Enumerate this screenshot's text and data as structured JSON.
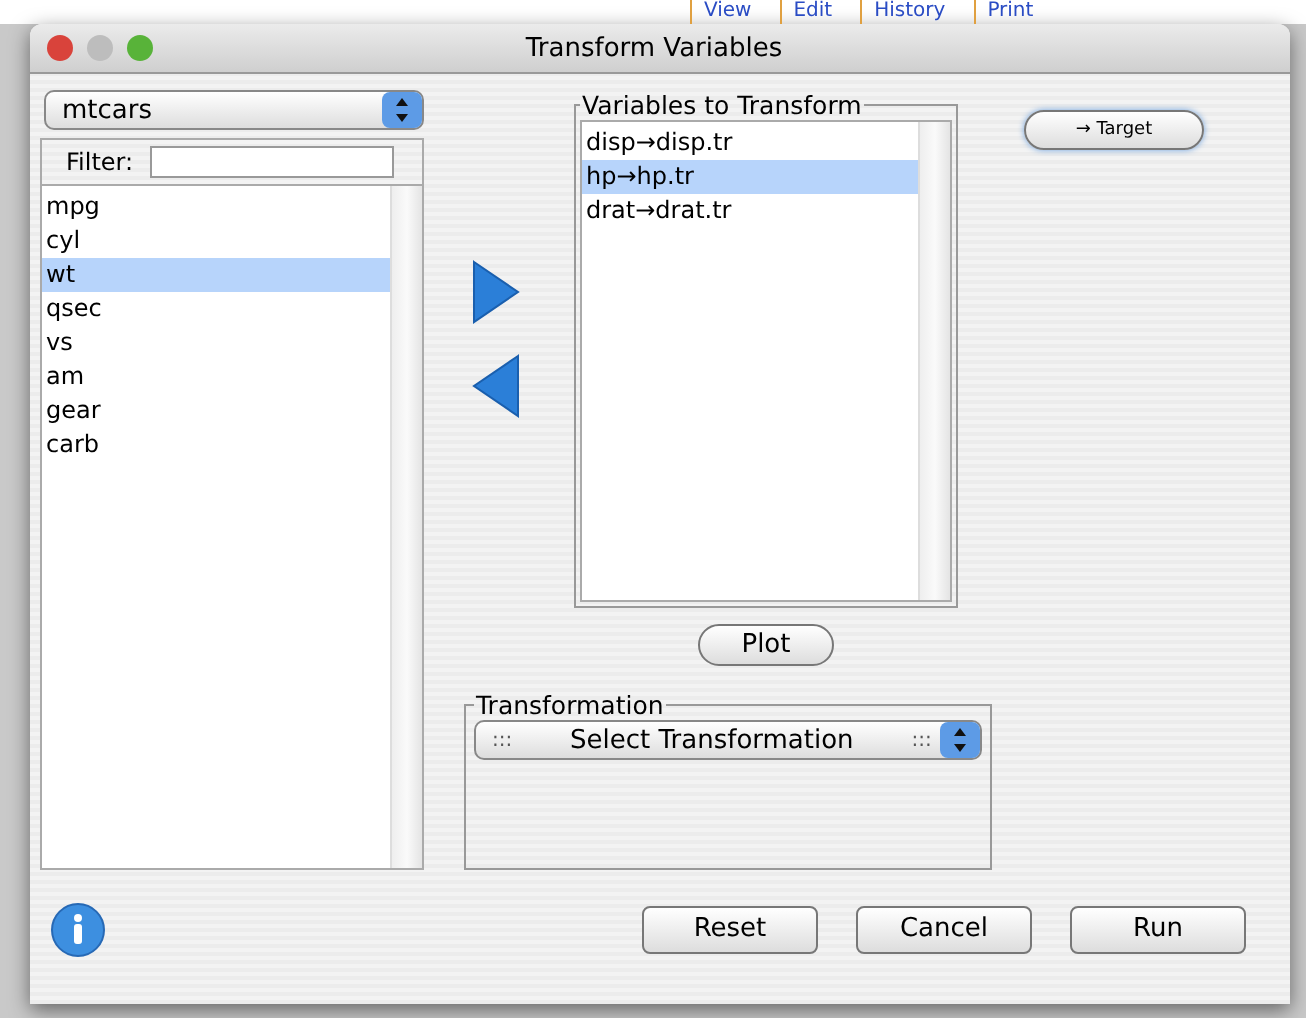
{
  "background_tabs": [
    "View",
    "Edit",
    "History",
    "Print"
  ],
  "window": {
    "title": "Transform Variables"
  },
  "dataset_select": {
    "value": "mtcars"
  },
  "filter": {
    "label": "Filter:"
  },
  "variables": [
    {
      "name": "mpg",
      "selected": false
    },
    {
      "name": "cyl",
      "selected": false
    },
    {
      "name": "wt",
      "selected": true
    },
    {
      "name": "qsec",
      "selected": false
    },
    {
      "name": "vs",
      "selected": false
    },
    {
      "name": "am",
      "selected": false
    },
    {
      "name": "gear",
      "selected": false
    },
    {
      "name": "carb",
      "selected": false
    }
  ],
  "transform_group": {
    "title": "Variables to Transform",
    "items": [
      {
        "label": "disp→disp.tr",
        "selected": false
      },
      {
        "label": "hp→hp.tr",
        "selected": true
      },
      {
        "label": "drat→drat.tr",
        "selected": false
      }
    ]
  },
  "target_button": "→ Target",
  "plot_button": "Plot",
  "transformation": {
    "title": "Transformation",
    "select": {
      "left_mark": ":::",
      "value": "Select Transformation",
      "right_mark": ":::"
    }
  },
  "buttons": [
    "Reset",
    "Cancel",
    "Run"
  ]
}
